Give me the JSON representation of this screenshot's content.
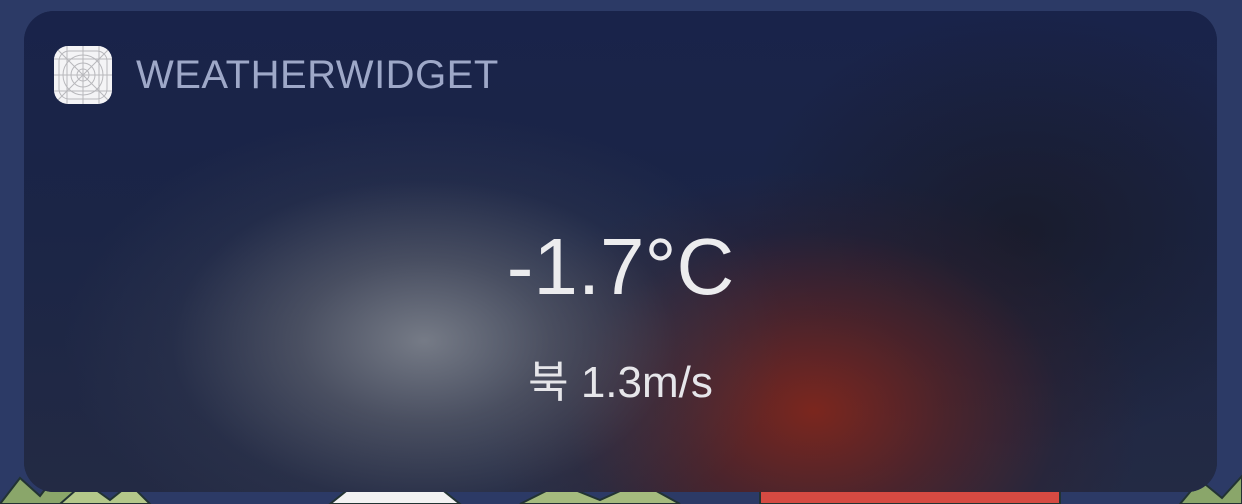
{
  "widget": {
    "app_name": "WEATHERWIDGET",
    "app_icon": "placeholder-app-icon",
    "temperature": "-1.7°C",
    "wind": "북 1.3m/s"
  },
  "colors": {
    "wallpaper": "#2c3a66",
    "widget_base": "#1a2444",
    "app_name_text": "#9ea8c8",
    "value_text": "#ececee",
    "warm_glow": "#80261c",
    "grey_glow": "#7d828c"
  }
}
